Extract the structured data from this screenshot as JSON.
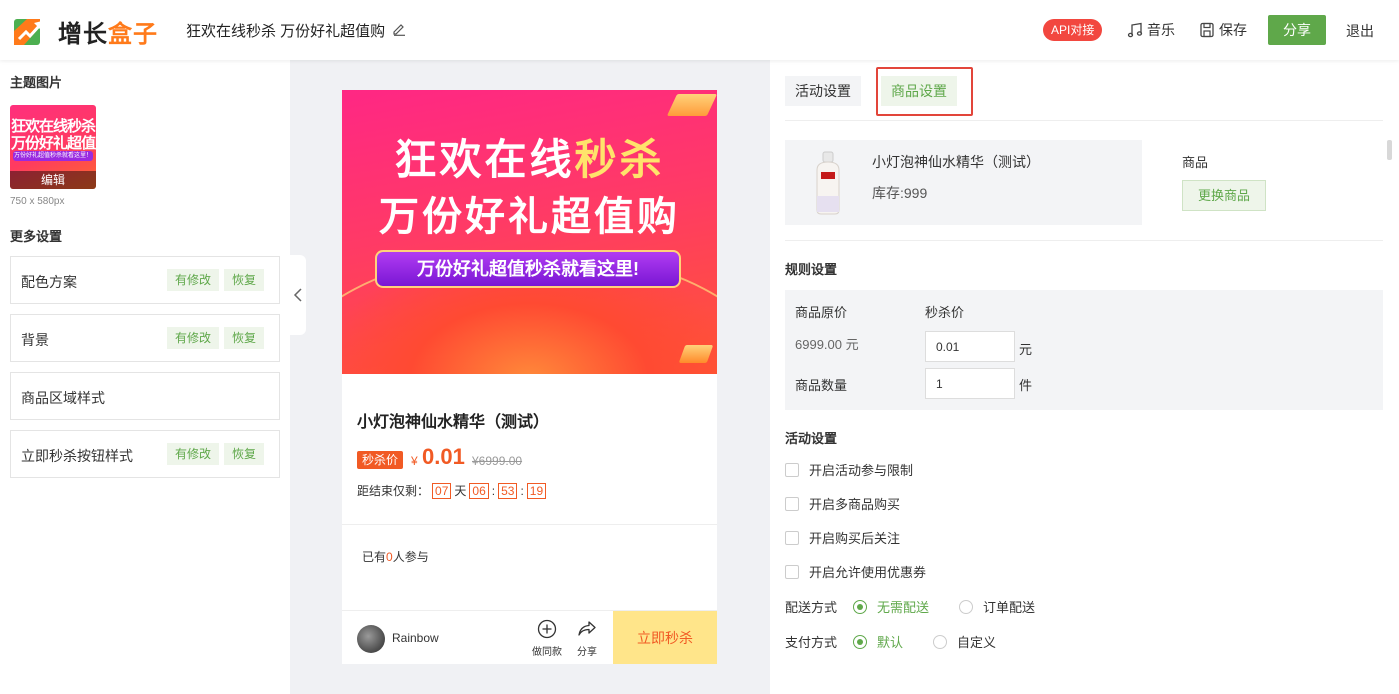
{
  "header": {
    "logo_main": "增长",
    "logo_accent": "盒子",
    "page_title": "狂欢在线秒杀 万份好礼超值购",
    "api_badge": "API对接",
    "music_label": "音乐",
    "save_label": "保存",
    "share_label": "分享",
    "exit_label": "退出",
    "accent_color": "#5fa84a"
  },
  "left": {
    "theme_title": "主题图片",
    "thumb_line1": "狂欢在线秒杀",
    "thumb_line2": "万份好礼超值购",
    "thumb_line3": "万份好礼超值秒杀就看这里！",
    "thumb_edit": "编辑",
    "thumb_size": "750 x 580px",
    "more_title": "更多设置",
    "rows": [
      {
        "label": "配色方案",
        "modified": "有修改",
        "restore": "恢复"
      },
      {
        "label": "背景",
        "modified": "有修改",
        "restore": "恢复"
      },
      {
        "label": "商品区域样式"
      },
      {
        "label": "立即秒杀按钮样式",
        "modified": "有修改",
        "restore": "恢复"
      }
    ]
  },
  "preview": {
    "banner_line1_a": "狂欢在线",
    "banner_line1_b": "秒杀",
    "banner_line2": "万份好礼超值购",
    "banner_pill": "万份好礼超值秒杀就看这里!",
    "product_name": "小灯泡神仙水精华（测试）",
    "price_tag": "秒杀价",
    "currency": "¥",
    "price": "0.01",
    "original_price": "¥6999.00",
    "countdown_label": "距结束仅剩：",
    "days": "07",
    "day_unit": "天",
    "hours": "06",
    "minutes": "53",
    "seconds": "19",
    "sep": ":",
    "joined_prefix": "已有",
    "joined_count": "0",
    "joined_suffix": "人参与",
    "username": "Rainbow",
    "same_style_label": "做同款",
    "share_label": "分享",
    "buy_label": "立即秒杀"
  },
  "right": {
    "tabs": [
      {
        "label": "活动设置",
        "active": false
      },
      {
        "label": "商品设置",
        "active": true
      }
    ],
    "product_name": "小灯泡神仙水精华（测试）",
    "stock": "库存:999",
    "product_label": "商品",
    "swap_button": "更换商品",
    "rule_title": "规则设置",
    "orig_price_label": "商品原价",
    "orig_price_value": "6999.00 元",
    "seckill_price_label": "秒杀价",
    "seckill_price_value": "0.01",
    "price_unit": "元",
    "qty_label": "商品数量",
    "qty_value": "1",
    "qty_unit": "件",
    "activity_title": "活动设置",
    "checkboxes": [
      {
        "label": "开启活动参与限制",
        "checked": false
      },
      {
        "label": "开启多商品购买",
        "checked": false
      },
      {
        "label": "开启购买后关注",
        "checked": false
      },
      {
        "label": "开启允许使用优惠券",
        "checked": false
      }
    ],
    "delivery_label": "配送方式",
    "delivery_options": [
      {
        "label": "无需配送",
        "selected": true
      },
      {
        "label": "订单配送",
        "selected": false
      }
    ],
    "payment_label": "支付方式",
    "payment_options": [
      {
        "label": "默认",
        "selected": true
      },
      {
        "label": "自定义",
        "selected": false
      }
    ]
  }
}
